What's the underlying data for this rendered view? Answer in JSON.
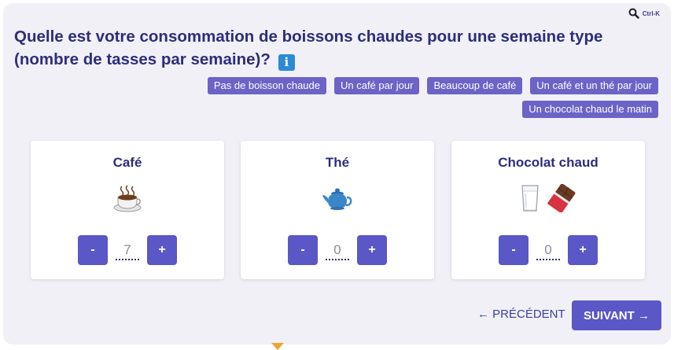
{
  "search": {
    "shortcut": "Ctrl-K",
    "icon": "search-icon"
  },
  "question": {
    "text": "Quelle est votre consommation de boissons chaudes pour une semaine type (nombre de tasses par semaine)?",
    "info_label": "i"
  },
  "presets": [
    {
      "label": "Pas de boisson chaude"
    },
    {
      "label": "Un café par jour"
    },
    {
      "label": "Beaucoup de café"
    },
    {
      "label": "Un café et un thé par jour"
    },
    {
      "label": "Un chocolat chaud le matin"
    }
  ],
  "cards": [
    {
      "title": "Café",
      "value": "7",
      "minus": "-",
      "plus": "+",
      "icons": [
        "hot-coffee-icon"
      ]
    },
    {
      "title": "Thé",
      "value": "0",
      "minus": "-",
      "plus": "+",
      "icons": [
        "teapot-icon"
      ]
    },
    {
      "title": "Chocolat chaud",
      "value": "0",
      "minus": "-",
      "plus": "+",
      "icons": [
        "milk-glass-icon",
        "chocolate-bar-icon"
      ]
    }
  ],
  "nav": {
    "prev_label": "← PRÉCÉDENT",
    "next_label": "SUIVANT →"
  },
  "colors": {
    "accent": "#5a57c6",
    "preset": "#6c63c7",
    "title": "#2c2e7c",
    "info": "#2c8ad6",
    "background": "#f1f0f7"
  }
}
